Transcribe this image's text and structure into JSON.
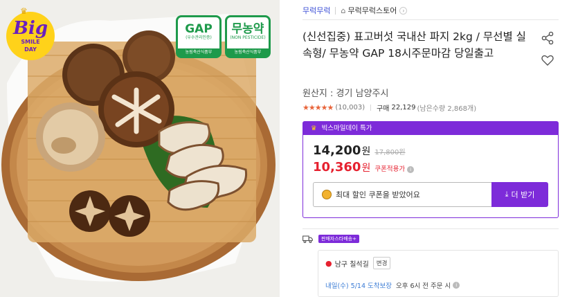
{
  "image": {
    "badge_big": "Big",
    "badge_smile": "SMILE",
    "badge_day": "DAY",
    "cert_gap": {
      "mark": "GAP",
      "sub": "(우수관리인증)",
      "issuer": "농림축산식품부"
    },
    "cert_pesticide": {
      "mark": "무농약",
      "sub": "(NON PESTICIDE)",
      "issuer": "농림축산식품부"
    }
  },
  "store": {
    "name": "무럭무럭",
    "link": "무럭무럭스토어",
    "home_icon": "home-icon",
    "link_icon": "chevron-right-icon"
  },
  "product": {
    "title": "(신선집중) 표고버섯 국내산 파지 2kg / 무선별 실속형/ 무농약 GAP 18시주문마감 당일출고",
    "origin": "원산지 : 경기 남양주시",
    "stars": "★★★★★",
    "rating": 4.5,
    "review_count": "(10,003)",
    "buy_label": "구매",
    "buy_count": "22,129",
    "stock": "(남은수량 2,868개)"
  },
  "deal": {
    "header": "빅스마일데이 특가",
    "price": "14,200",
    "won": "원",
    "original_price": "17,800원",
    "coupon_price": "10,360",
    "coupon_tag": "쿠폰적용가",
    "info_glyph": "i",
    "coupon_message": "최대 할인 쿠폰을 받았어요",
    "download_label": "더 받기",
    "download_glyph": "⤓"
  },
  "shipping": {
    "badge": "판매자스타배송+",
    "address": "남구 칠석길",
    "change_label": "변경",
    "delivery_date": "내일(수) 5/14",
    "guarantee": "도착보장",
    "cutoff": "오후 6시 전 주문 시"
  },
  "colors": {
    "purple": "#7d2bd9",
    "red": "#e6212f",
    "blue": "#3a4dd6",
    "star": "#e8643a",
    "gap_green": "#1e9a4b"
  }
}
